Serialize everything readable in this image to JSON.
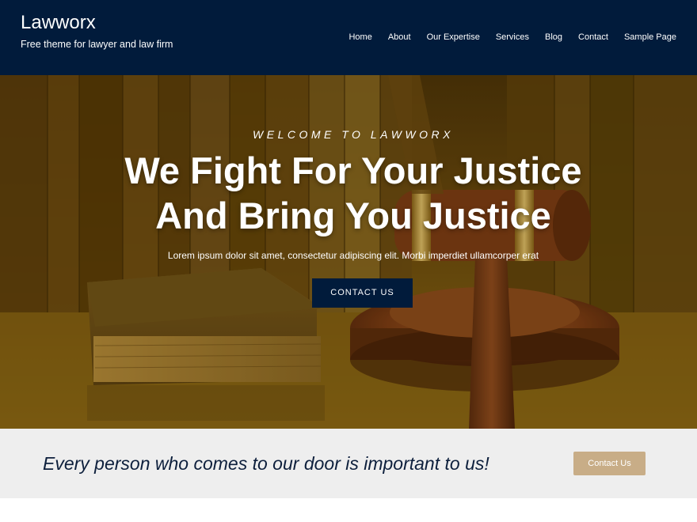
{
  "header": {
    "site_title": "Lawworx",
    "tagline": "Free theme for lawyer and law firm",
    "nav": [
      {
        "label": "Home"
      },
      {
        "label": "About"
      },
      {
        "label": "Our Expertise"
      },
      {
        "label": "Services"
      },
      {
        "label": "Blog"
      },
      {
        "label": "Contact"
      },
      {
        "label": "Sample Page"
      }
    ]
  },
  "hero": {
    "eyebrow": "WELCOME TO LAWWORX",
    "heading_line1": "We Fight For Your Justice",
    "heading_line2": "And Bring You Justice",
    "text": "Lorem ipsum dolor sit amet, consectetur adipiscing elit. Morbi imperdiet ullamcorper erat",
    "cta_label": "CONTACT US",
    "background_icon": "gavel-and-book-image"
  },
  "cta_band": {
    "text": "Every person who comes to our door is important to us!",
    "button_label": "Contact Us"
  },
  "colors": {
    "header_bg": "#011b3b",
    "hero_button_bg": "#011b3b",
    "cta_band_bg": "#eeeeee",
    "cta_button_bg": "#c8ad87",
    "cta_text": "#0d1f3c"
  }
}
